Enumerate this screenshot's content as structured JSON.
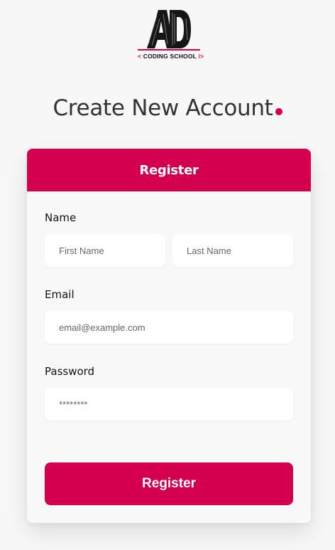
{
  "brand": {
    "logo_letters": "AD",
    "logo_caption": "CODING SCHOOL",
    "caption_open": "<",
    "caption_close": "/>"
  },
  "colors": {
    "accent": "#d4004f",
    "title": "#333333",
    "card_bg": "#f8f8f8",
    "page_bg": "#f7f7f7"
  },
  "heading": {
    "title": "Create New Account"
  },
  "form": {
    "header_title": "Register",
    "name_label": "Name",
    "first_name_placeholder": "First Name",
    "last_name_placeholder": "Last Name",
    "email_label": "Email",
    "email_placeholder": "email@example.com",
    "password_label": "Password",
    "password_placeholder": "********",
    "submit_label": "Register"
  }
}
